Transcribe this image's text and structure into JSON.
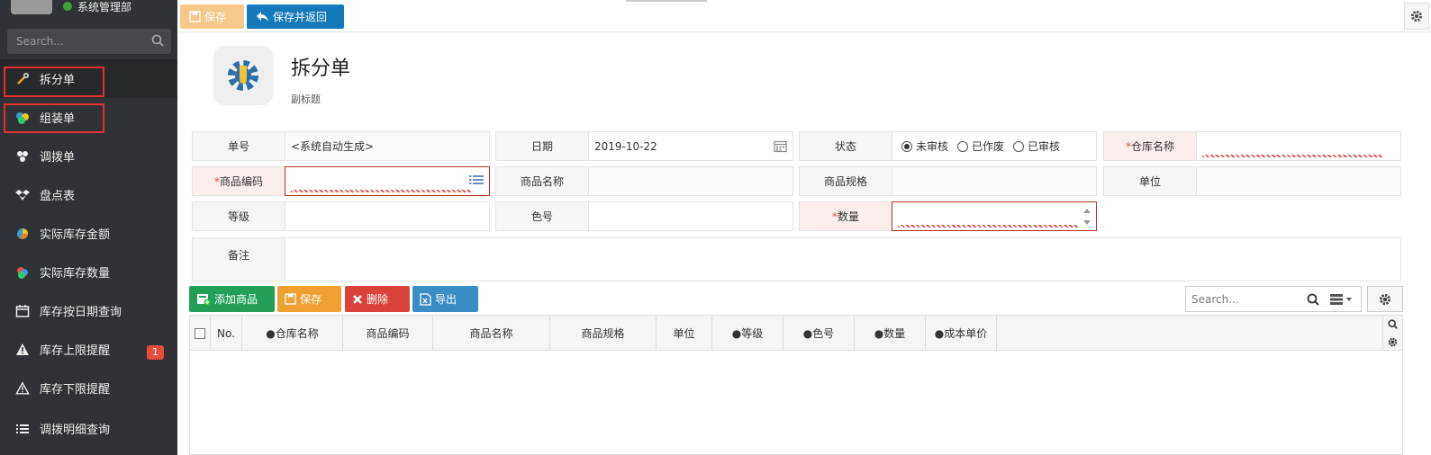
{
  "sidebar": {
    "user_name": "系统管理部",
    "search_placeholder": "Search...",
    "items": [
      {
        "label": "拆分单",
        "icon": "wrench-icon"
      },
      {
        "label": "组装单",
        "icon": "cubes-icon"
      },
      {
        "label": "调拨单",
        "icon": "transfer-icon"
      },
      {
        "label": "盘点表",
        "icon": "dropbox-icon"
      },
      {
        "label": "实际库存金额",
        "icon": "pie-icon"
      },
      {
        "label": "实际库存数量",
        "icon": "layers-icon"
      },
      {
        "label": "库存按日期查询",
        "icon": "calendar-icon"
      },
      {
        "label": "库存上限提醒",
        "icon": "warning-icon",
        "badge": "1"
      },
      {
        "label": "库存下限提醒",
        "icon": "warning-outline-icon"
      },
      {
        "label": "调拨明细查询",
        "icon": "list-icon"
      }
    ]
  },
  "toolbar": {
    "save_label": "保存",
    "save_return_label": "保存并返回"
  },
  "header": {
    "title": "拆分单",
    "subtitle": "副标题"
  },
  "form": {
    "order_no": {
      "label": "单号",
      "value": "<系统自动生成>"
    },
    "date": {
      "label": "日期",
      "value": "2019-10-22"
    },
    "status": {
      "label": "状态",
      "options": [
        "未审核",
        "已作废",
        "已审核"
      ],
      "selected": "未审核"
    },
    "warehouse": {
      "label": "仓库名称",
      "required": true,
      "value": ""
    },
    "product_code": {
      "label": "商品编码",
      "required": true,
      "value": ""
    },
    "product_name": {
      "label": "商品名称",
      "value": ""
    },
    "product_spec": {
      "label": "商品规格",
      "value": ""
    },
    "unit": {
      "label": "单位",
      "value": ""
    },
    "grade": {
      "label": "等级",
      "value": ""
    },
    "color_no": {
      "label": "色号",
      "value": ""
    },
    "quantity": {
      "label": "数量",
      "required": true,
      "value": ""
    },
    "remark": {
      "label": "备注",
      "value": ""
    }
  },
  "grid_toolbar": {
    "add_label": "添加商品",
    "save_label": "保存",
    "delete_label": "删除",
    "export_label": "导出",
    "search_placeholder": "Search..."
  },
  "grid": {
    "columns": [
      "No.",
      "●仓库名称",
      "商品编码",
      "商品名称",
      "商品规格",
      "单位",
      "●等级",
      "●色号",
      "●数量",
      "●成本单价"
    ],
    "rows": []
  },
  "colors": {
    "sidebar_bg": "#2f3236",
    "primary": "#1479b8",
    "success": "#22a05a",
    "warning": "#f0a030",
    "danger": "#d9433a",
    "info": "#3a8cc4",
    "highlight_box": "#e0302f"
  }
}
